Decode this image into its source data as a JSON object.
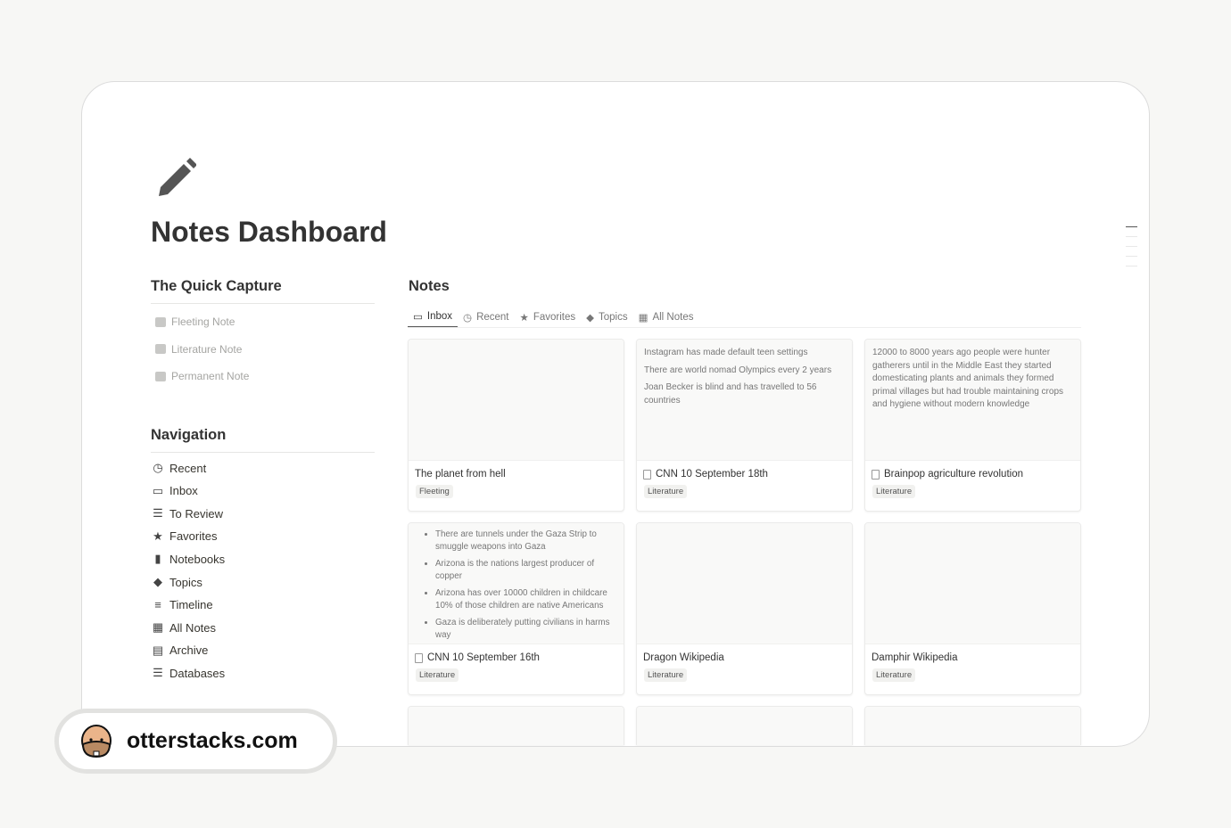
{
  "page": {
    "title": "Notes Dashboard",
    "icon": "pencil-icon"
  },
  "quick_capture": {
    "heading": "The Quick Capture",
    "items": [
      {
        "label": "Fleeting Note",
        "icon": "brain-icon"
      },
      {
        "label": "Literature Note",
        "icon": "book-icon"
      },
      {
        "label": "Permanent Note",
        "icon": "note-icon"
      }
    ]
  },
  "navigation": {
    "heading": "Navigation",
    "items": [
      {
        "label": "Recent",
        "icon": "clock-icon",
        "glyph": "◷"
      },
      {
        "label": "Inbox",
        "icon": "inbox-icon",
        "glyph": "▭"
      },
      {
        "label": "To Review",
        "icon": "list-icon",
        "glyph": "☰"
      },
      {
        "label": "Favorites",
        "icon": "star-icon",
        "glyph": "★"
      },
      {
        "label": "Notebooks",
        "icon": "notebook-icon",
        "glyph": "▮"
      },
      {
        "label": "Topics",
        "icon": "tag-icon",
        "glyph": "◆"
      },
      {
        "label": "Timeline",
        "icon": "timeline-icon",
        "glyph": "≡"
      },
      {
        "label": "All Notes",
        "icon": "notes-icon",
        "glyph": "▦"
      },
      {
        "label": "Archive",
        "icon": "archive-icon",
        "glyph": "▤"
      },
      {
        "label": "Databases",
        "icon": "database-icon",
        "glyph": "☰"
      }
    ]
  },
  "notes": {
    "heading": "Notes",
    "tabs": [
      {
        "label": "Inbox",
        "icon": "inbox-icon",
        "glyph": "▭",
        "active": true
      },
      {
        "label": "Recent",
        "icon": "clock-icon",
        "glyph": "◷"
      },
      {
        "label": "Favorites",
        "icon": "star-icon",
        "glyph": "★"
      },
      {
        "label": "Topics",
        "icon": "tag-icon",
        "glyph": "◆"
      },
      {
        "label": "All Notes",
        "icon": "notes-icon",
        "glyph": "▦"
      }
    ],
    "cards": [
      {
        "title": "The planet from hell",
        "tag": "Fleeting",
        "doc": false,
        "lines": [],
        "bullets": []
      },
      {
        "title": "CNN 10 September 18th",
        "tag": "Literature",
        "doc": true,
        "lines": [
          "Instagram has made default teen settings",
          "There are world nomad Olympics every 2 years",
          "Joan Becker is blind and has travelled to 56 countries"
        ],
        "bullets": []
      },
      {
        "title": "Brainpop agriculture revolution",
        "tag": "Literature",
        "doc": true,
        "lines": [
          "12000 to 8000 years ago people were hunter gatherers until in the Middle East they started domesticating plants and animals they formed primal villages but had trouble maintaining crops and hygiene without modern knowledge"
        ],
        "bullets": []
      },
      {
        "title": "CNN 10 September 16th",
        "tag": "Literature",
        "doc": true,
        "lines": [],
        "bullets": [
          "There are tunnels under the Gaza Strip to smuggle weapons into Gaza",
          "Arizona is the nations largest producer of copper",
          "Arizona has over 10000 children in childcare 10% of those children are native Americans",
          "Gaza is deliberately putting civilians in harms way"
        ]
      },
      {
        "title": "Dragon Wikipedia",
        "tag": "Literature",
        "doc": false,
        "lines": [],
        "bullets": []
      },
      {
        "title": "Damphir Wikipedia",
        "tag": "Literature",
        "doc": false,
        "lines": [],
        "bullets": []
      },
      {
        "title": "",
        "tag": "",
        "doc": false,
        "lines": [],
        "bullets": []
      },
      {
        "title": "",
        "tag": "",
        "doc": false,
        "lines": [],
        "bullets": []
      },
      {
        "title": "",
        "tag": "",
        "doc": false,
        "lines": [],
        "bullets": []
      }
    ]
  },
  "watermark": {
    "text": "otterstacks.com",
    "icon": "otter-icon"
  }
}
